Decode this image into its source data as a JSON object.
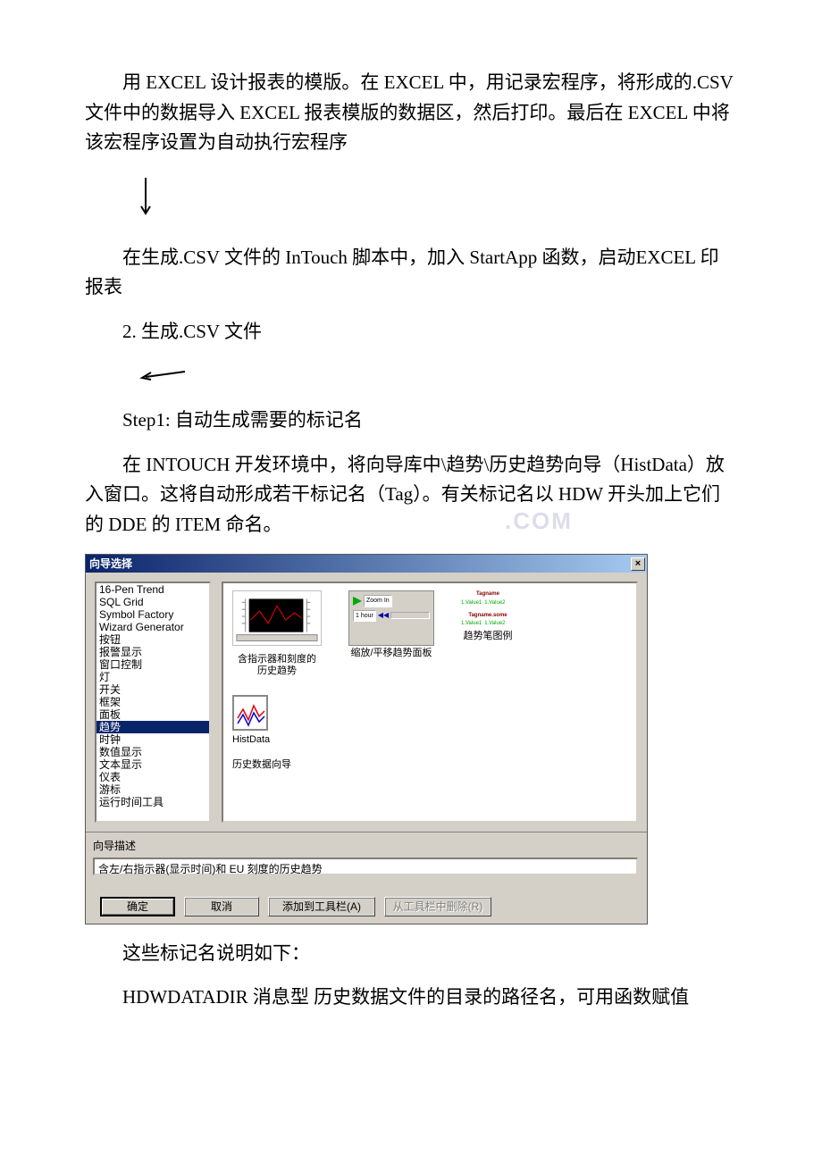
{
  "paragraphs": {
    "p1": "用 EXCEL 设计报表的模版。在 EXCEL 中，用记录宏程序，将形成的.CSV 文件中的数据导入 EXCEL 报表模版的数据区，然后打印。最后在 EXCEL 中将该宏程序设置为自动执行宏程序",
    "p2": "在生成.CSV 文件的 InTouch 脚本中，加入 StartApp 函数，启动EXCEL 印报表",
    "p3": "2. 生成.CSV 文件",
    "p4": "Step1: 自动生成需要的标记名",
    "p5": "在 INTOUCH 开发环境中，将向导库中\\趋势\\历史趋势向导（HistData）放入窗口。这将自动形成若干标记名（Tag）。有关标记名以 HDW 开头加上它们的 DDE 的 ITEM 命名。",
    "p6": "这些标记名说明如下：",
    "p7": "HDWDATADIR 消息型 历史数据文件的目录的路径名，可用函数赋值"
  },
  "watermark": ".COM",
  "dialog": {
    "title": "向导选择",
    "close": "×",
    "list": {
      "items": [
        "16-Pen Trend",
        "SQL Grid",
        "Symbol Factory",
        "Wizard Generator",
        "按钮",
        "报警显示",
        "窗口控制",
        "灯",
        "开关",
        "框架",
        "面板",
        "趋势",
        "时钟",
        "数值显示",
        "文本显示",
        "仪表",
        "游标",
        "运行时间工具"
      ],
      "selected_index": 11
    },
    "preview": {
      "items": [
        {
          "label_line1": "含指示器和刻度的",
          "label_line2": "历史趋势"
        },
        {
          "label_line1": "缩放/平移趋势面板",
          "label_line2": ""
        },
        {
          "label_line1": "趋势笔图例",
          "label_line2": ""
        }
      ],
      "second_row": {
        "name": "HistData",
        "label": "历史数据向导"
      },
      "zoom_text": "Zoom In",
      "hour_text": "1 hour"
    },
    "desc_label": "向导描述",
    "desc_text": "含左/右指示器(显示时间)和 EU 刻度的历史趋势",
    "buttons": {
      "ok": "确定",
      "cancel": "取消",
      "add": "添加到工具栏(A)",
      "remove": "从工具栏中删除(R)"
    }
  }
}
